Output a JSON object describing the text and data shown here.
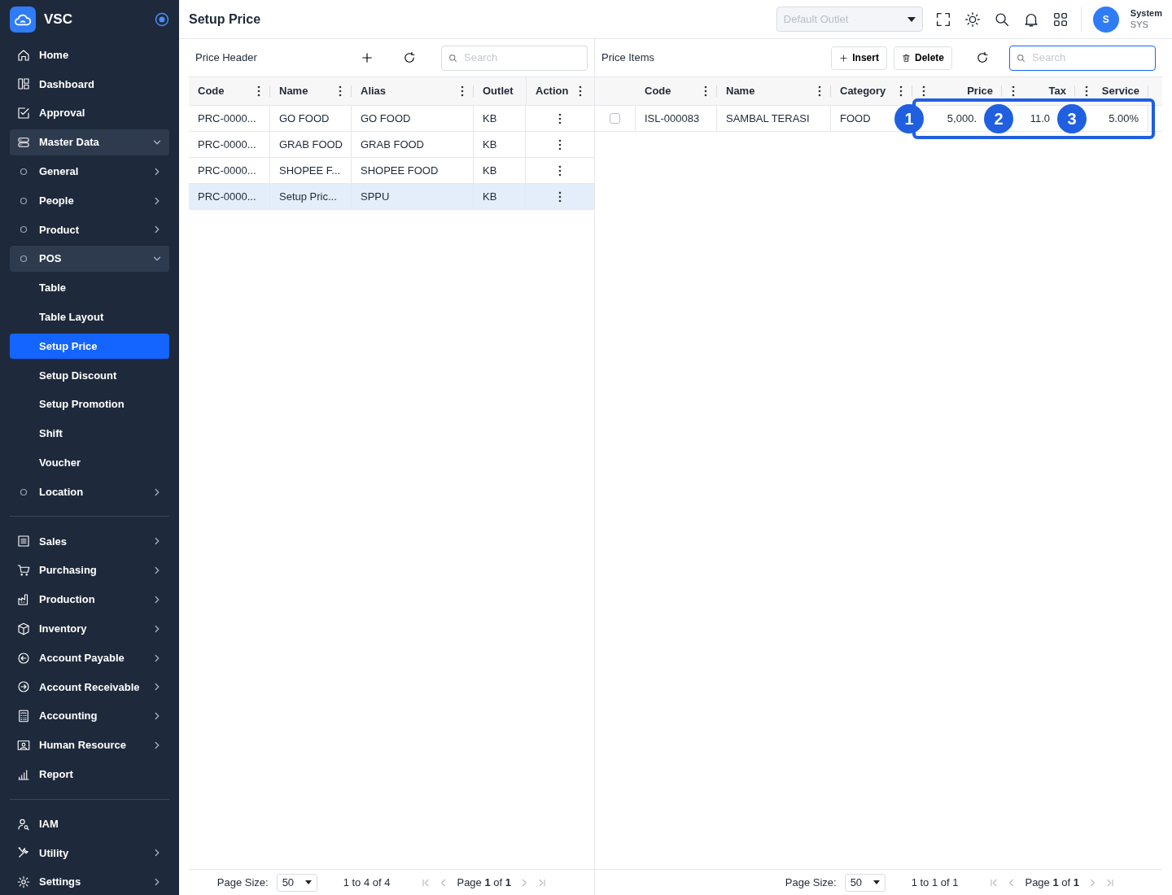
{
  "sidebar": {
    "brand": "VSC",
    "sections": [
      {
        "items": [
          {
            "label": "Home",
            "selected": false
          },
          {
            "label": "Dashboard",
            "selected": false
          },
          {
            "label": "Approval",
            "selected": false
          },
          {
            "label": "Master Data",
            "selected": false,
            "expanded": true,
            "children": [
              {
                "label": "General",
                "selected": false,
                "expanded": false
              },
              {
                "label": "People",
                "selected": false,
                "expanded": false
              },
              {
                "label": "Product",
                "selected": false,
                "expanded": false
              },
              {
                "label": "POS",
                "selected": false,
                "expanded": true,
                "children": [
                  {
                    "label": "Table",
                    "selected": false
                  },
                  {
                    "label": "Table Layout",
                    "selected": false
                  },
                  {
                    "label": "Setup Price",
                    "selected": true
                  },
                  {
                    "label": "Setup Discount",
                    "selected": false
                  },
                  {
                    "label": "Setup Promotion",
                    "selected": false
                  },
                  {
                    "label": "Shift",
                    "selected": false
                  },
                  {
                    "label": "Voucher",
                    "selected": false
                  }
                ]
              },
              {
                "label": "Location",
                "selected": false,
                "expanded": false
              }
            ]
          }
        ]
      },
      {
        "items": [
          {
            "label": "Sales",
            "selected": false,
            "expanded": false
          },
          {
            "label": "Purchasing",
            "selected": false,
            "expanded": false
          },
          {
            "label": "Production",
            "selected": false,
            "expanded": false
          },
          {
            "label": "Inventory",
            "selected": false,
            "expanded": false
          },
          {
            "label": "Account Payable",
            "selected": false,
            "expanded": false
          },
          {
            "label": "Account Receivable",
            "selected": false,
            "expanded": false
          },
          {
            "label": "Accounting",
            "selected": false,
            "expanded": false
          },
          {
            "label": "Human Resource",
            "selected": false,
            "expanded": false
          },
          {
            "label": "Report",
            "selected": false
          }
        ]
      },
      {
        "items": [
          {
            "label": "IAM",
            "selected": false
          },
          {
            "label": "Utility",
            "selected": false,
            "expanded": false
          },
          {
            "label": "Settings",
            "selected": false,
            "expanded": false
          }
        ]
      }
    ]
  },
  "topbar": {
    "title": "Setup Price",
    "outlet_select": {
      "placeholder": "Default Outlet"
    },
    "user": {
      "initial": "S",
      "name": "System",
      "code": "SYS"
    }
  },
  "price_header": {
    "title": "Price Header",
    "search": {
      "placeholder": "Search",
      "focused": false
    },
    "columns": [
      {
        "label": "Code",
        "kind": "text",
        "menu": true
      },
      {
        "label": "Name",
        "kind": "text",
        "menu": true
      },
      {
        "label": "Alias",
        "kind": "text",
        "menu": true
      },
      {
        "label": "Outlet",
        "kind": "text",
        "menu": false
      },
      {
        "label": "Action",
        "kind": "text",
        "menu": true
      }
    ],
    "rows": [
      {
        "selected": false,
        "cells": [
          "PRC-0000...",
          "GO FOOD",
          "GO FOOD",
          "KB"
        ]
      },
      {
        "selected": false,
        "cells": [
          "PRC-0000...",
          "GRAB FOOD",
          "GRAB FOOD",
          "KB"
        ]
      },
      {
        "selected": false,
        "cells": [
          "PRC-0000...",
          "SHOPEE F...",
          "SHOPEE FOOD",
          "KB"
        ]
      },
      {
        "selected": true,
        "cells": [
          "PRC-0000...",
          "Setup Pric...",
          "SPPU",
          "KB"
        ]
      }
    ],
    "pagination": {
      "page_size_label": "Page Size:",
      "page_size": "50",
      "range": "1 to 4 of 4",
      "page": "Page **1** of **1**"
    }
  },
  "price_items": {
    "title": "Price Items",
    "insert_button": "Insert",
    "delete_button": "Delete",
    "search": {
      "placeholder": "Search",
      "focused": true
    },
    "columns": [
      {
        "label": "Code",
        "kind": "text",
        "menu": true
      },
      {
        "label": "Name",
        "kind": "text",
        "menu": true
      },
      {
        "label": "Category",
        "kind": "text",
        "menu": true
      },
      {
        "label": "Price",
        "kind": "numeric",
        "menu": true
      },
      {
        "label": "Tax",
        "kind": "numeric",
        "menu": true
      },
      {
        "label": "Service",
        "kind": "numeric",
        "menu": true
      }
    ],
    "rows": [
      {
        "selected": false,
        "checked": false,
        "cells": [
          "ISL-000083",
          "SAMBAL TERASI",
          "FOOD",
          "5,000.",
          "11.0",
          "5.00%"
        ]
      }
    ],
    "annotations": [
      {
        "number": "1"
      },
      {
        "number": "2"
      },
      {
        "number": "3"
      }
    ],
    "pagination": {
      "page_size_label": "Page Size:",
      "page_size": "50",
      "range": "1 to 1 of 1",
      "page": "Page **1** of **1**"
    }
  }
}
